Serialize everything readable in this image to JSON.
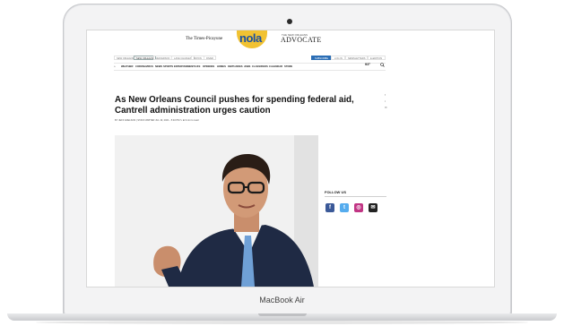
{
  "device": {
    "label": "MacBook Air"
  },
  "site": {
    "logo_tp": "The Times-Picayune",
    "logo_nola": "nola",
    "logo_adv_small": "THE NEW ORLEANS",
    "logo_adv": "ADVOCATE",
    "utility_tabs": [
      "NEW ORLEANS",
      "NEW ORLEANS",
      "JEFFERSON",
      "LAKE CHARLES",
      "BATON",
      "RIVER"
    ],
    "utility_right": {
      "subscribe": "SUBSCRIBE",
      "login": "LOG IN",
      "newsletters": "NEWSLETTERS",
      "eedition": "E-EDITION"
    },
    "nav": [
      "WEATHER",
      "CORONAVIRUS",
      "NEWS",
      "SPORTS",
      "ENTERTAINMENT/LIFE",
      "OPINIONS",
      "HOMES",
      "OBITUARIES",
      "JOBS",
      "CLASSIFIEDS",
      "CALENDAR",
      "STORE"
    ],
    "weather_temp": "93°"
  },
  "article": {
    "headline": "As New Orleans Council pushes for spending federal aid, Cantrell administration urges caution",
    "byline": "BY JEFF ADELSON | STAFF WRITER  JUL 19, 2021 - 5:40 PM",
    "read_time": "3 min to read"
  },
  "sidebar": {
    "follow_title": "FOLLOW US",
    "social": [
      {
        "icon": "facebook-icon",
        "glyph": "f",
        "color": "#3b5998"
      },
      {
        "icon": "twitter-icon",
        "glyph": "t",
        "color": "#55acee"
      },
      {
        "icon": "instagram-icon",
        "glyph": "◎",
        "color": "#c13584"
      },
      {
        "icon": "email-icon",
        "glyph": "✉",
        "color": "#222222"
      }
    ]
  }
}
